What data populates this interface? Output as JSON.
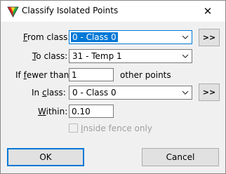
{
  "window": {
    "title": "Classify Isolated Points",
    "close_glyph": "✕"
  },
  "form": {
    "from_class": {
      "label_key": "F",
      "label_rest": "rom class:",
      "value": "0 - Class 0",
      "browse_label": ">>"
    },
    "to_class": {
      "label_key": "T",
      "label_rest": "o class:",
      "value": "31 - Temp 1"
    },
    "fewer_than": {
      "label_pre": "If ",
      "label_key": "f",
      "label_rest": "ewer than:",
      "value": "1",
      "suffix": "other points"
    },
    "in_class": {
      "label_pre": "In ",
      "label_key": "c",
      "label_rest": "lass:",
      "value": "0 - Class 0",
      "browse_label": ">>"
    },
    "within": {
      "label_key": "W",
      "label_rest": "ithin:",
      "value": "0.10"
    },
    "inside_fence": {
      "label_key": "I",
      "label_rest": "nside fence only",
      "checked": false,
      "enabled": false
    }
  },
  "buttons": {
    "ok": "OK",
    "cancel": "Cancel"
  },
  "colors": {
    "accent": "#0078d7",
    "dialog_bg": "#f0f0f0"
  },
  "icons": {
    "app": "triangle-color-icon",
    "dropdown": "chevron-down-icon"
  }
}
